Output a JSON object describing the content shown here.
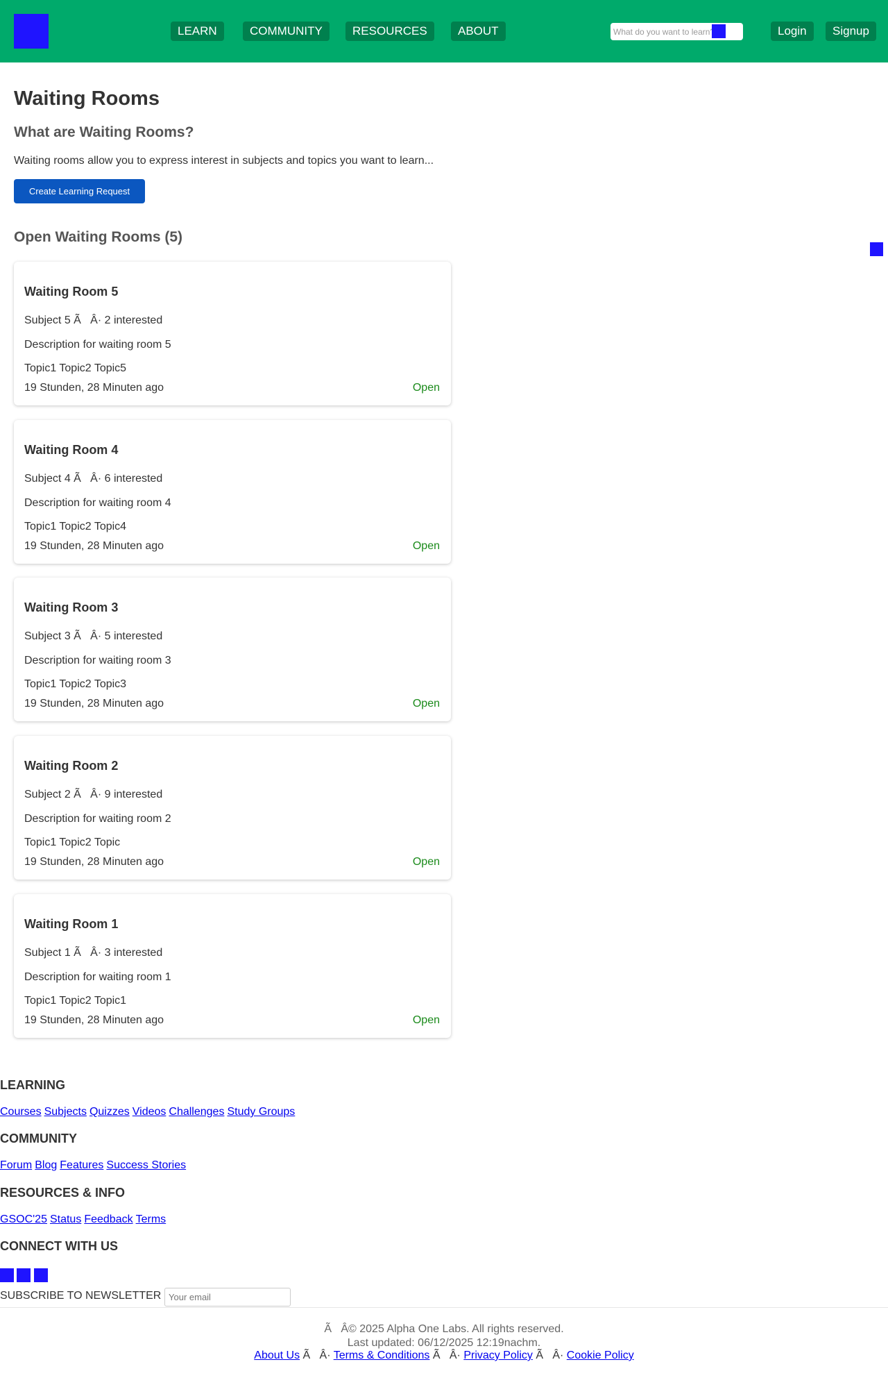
{
  "header": {
    "nav": [
      "LEARN",
      "COMMUNITY",
      "RESOURCES",
      "ABOUT"
    ],
    "search_placeholder": "What do you want to learn?",
    "login": "Login",
    "signup": "Signup"
  },
  "main": {
    "title": "Waiting Rooms",
    "intro_heading": "What are Waiting Rooms?",
    "intro_text": "Waiting rooms allow you to express interest in subjects and topics you want to learn...",
    "create_button": "Create Learning Request",
    "open_heading": "Open Waiting Rooms (5)",
    "rooms": [
      {
        "title": "Waiting Room 5",
        "meta": "Subject 5 Ã   Â· 2 interested",
        "description": "Description for waiting room 5",
        "topics": "Topic1 Topic2 Topic5",
        "time": "19 Stunden, 28 Minuten ago",
        "status": "Open"
      },
      {
        "title": "Waiting Room 4",
        "meta": "Subject 4 Ã   Â· 6 interested",
        "description": "Description for waiting room 4",
        "topics": "Topic1 Topic2 Topic4",
        "time": "19 Stunden, 28 Minuten ago",
        "status": "Open"
      },
      {
        "title": "Waiting Room 3",
        "meta": "Subject 3 Ã   Â· 5 interested",
        "description": "Description for waiting room 3",
        "topics": "Topic1 Topic2 Topic3",
        "time": "19 Stunden, 28 Minuten ago",
        "status": "Open"
      },
      {
        "title": "Waiting Room 2",
        "meta": "Subject 2 Ã   Â· 9 interested",
        "description": "Description for waiting room 2",
        "topics": "Topic1 Topic2 Topic",
        "time": "19 Stunden, 28 Minuten ago",
        "status": "Open"
      },
      {
        "title": "Waiting Room 1",
        "meta": "Subject 1 Ã   Â· 3 interested",
        "description": "Description for waiting room 1",
        "topics": "Topic1 Topic2 Topic1",
        "time": "19 Stunden, 28 Minuten ago",
        "status": "Open"
      }
    ]
  },
  "footer": {
    "learning_heading": "LEARNING",
    "learning_links": [
      "Courses",
      "Subjects",
      "Quizzes",
      "Videos",
      "Challenges",
      "Study Groups"
    ],
    "community_heading": "COMMUNITY",
    "community_links": [
      "Forum",
      "Blog",
      "Features",
      "Success Stories"
    ],
    "resources_heading": "RESOURCES & INFO",
    "resources_links": [
      "GSOC'25",
      "Status",
      "Feedback",
      "Terms"
    ],
    "connect_heading": "CONNECT WITH US",
    "newsletter_label": "SUBSCRIBE TO NEWSLETTER",
    "newsletter_placeholder": "Your email",
    "copyright": "Ã   Â© 2025 Alpha One Labs. All rights reserved.",
    "last_updated": "Last updated: 06/12/2025 12:19nachm.",
    "legal_links": [
      "About Us",
      "Terms & Conditions",
      "Privacy Policy",
      "Cookie Policy"
    ],
    "legal_separator": " Ã   Â· "
  },
  "colors": {
    "header_bg": "#00AA6B",
    "nav_button_bg": "#00804E",
    "primary_button": "#0B57C0",
    "placeholder_blocks": "#1F14FF",
    "status_open": "#1A8A1A",
    "link": "#0000EE"
  }
}
